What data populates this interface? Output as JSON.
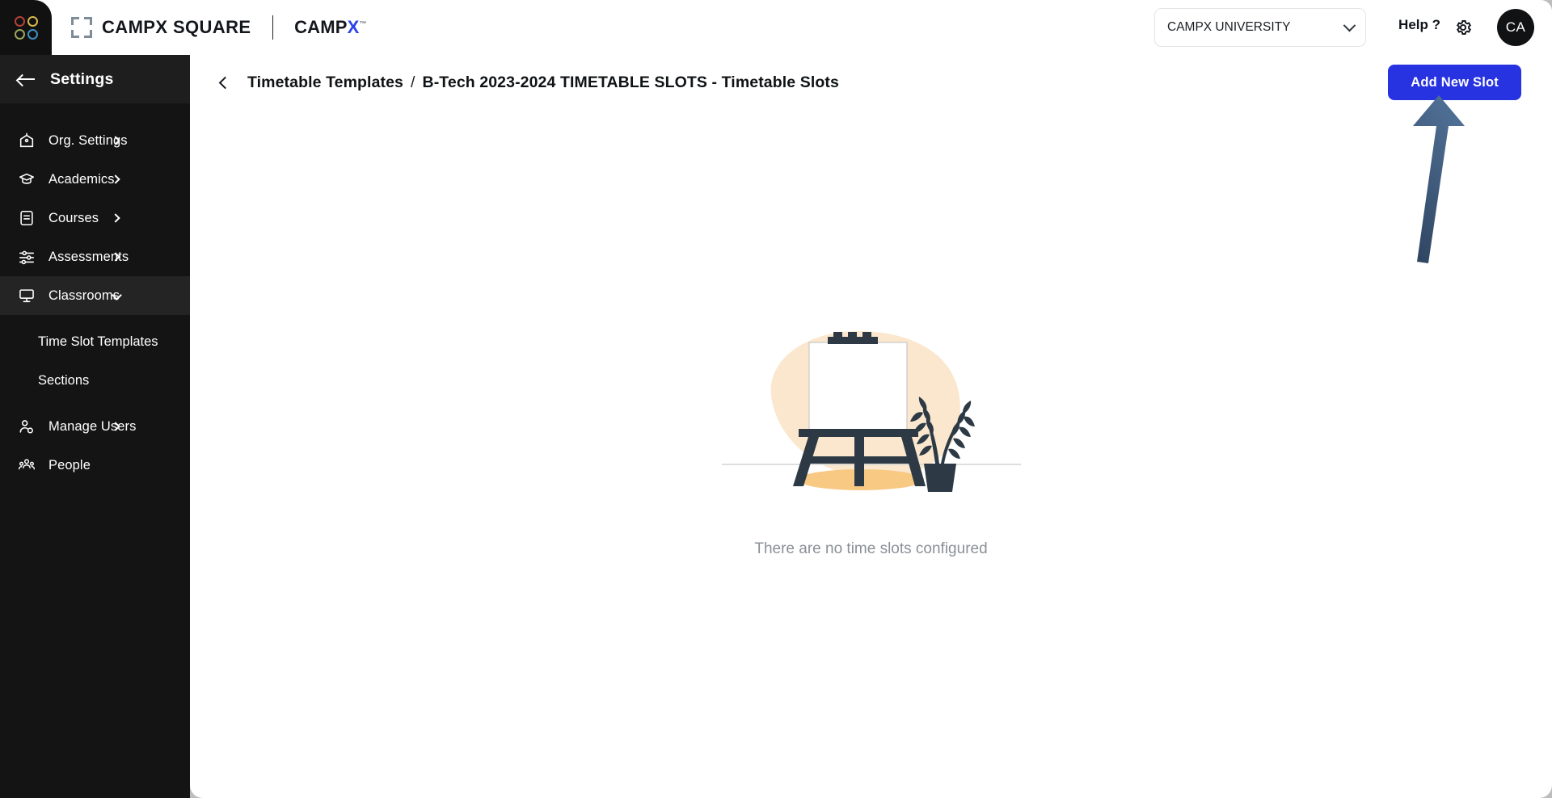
{
  "topbar": {
    "logo_icon": "four-circles-logo",
    "logo_dot_colors": [
      "#b4413a",
      "#d9b84a",
      "#9aa85a",
      "#3f8fc4"
    ],
    "bracket_icon": "expand-brackets-icon",
    "brand_title": "CAMPX SQUARE",
    "brand_alt_prefix": "CAMP",
    "brand_alt_accent": "X",
    "brand_accent_color": "#2b43e8",
    "org_select_value": "CAMPX UNIVERSITY",
    "org_select_icon": "chevron-down-icon",
    "help_label": "Help ?",
    "settings_icon": "gear-icon",
    "avatar_initials": "CA"
  },
  "sidebar": {
    "back_icon": "arrow-left-icon",
    "title": "Settings",
    "items": [
      {
        "label": "Org. Settings",
        "icon": "org-building-icon",
        "chevron": "chevron-right-icon",
        "active": false
      },
      {
        "label": "Academics",
        "icon": "graduation-cap-icon",
        "chevron": "chevron-right-icon",
        "active": false
      },
      {
        "label": "Courses",
        "icon": "document-icon",
        "chevron": "chevron-right-icon",
        "active": false
      },
      {
        "label": "Assessments",
        "icon": "sliders-icon",
        "chevron": "chevron-right-icon",
        "active": false
      },
      {
        "label": "Classrooms",
        "icon": "monitor-icon",
        "chevron": "chevron-down-icon",
        "active": true
      }
    ],
    "sub_items": [
      {
        "label": "Time Slot Templates"
      },
      {
        "label": "Sections"
      }
    ],
    "items_after": [
      {
        "label": "Manage Users",
        "icon": "user-gear-icon",
        "chevron": "chevron-right-icon",
        "active": false
      },
      {
        "label": "People",
        "icon": "people-icon",
        "chevron": "",
        "active": false
      }
    ]
  },
  "main": {
    "back_icon": "chevron-left-icon",
    "breadcrumb_parent": "Timetable Templates",
    "breadcrumb_separator": "/",
    "breadcrumb_current": "B-Tech 2023-2024 TIMETABLE SLOTS - Timetable Slots",
    "add_button_label": "Add New Slot",
    "add_button_color": "#2732e0",
    "empty_illustration": "easel-with-plant-illustration",
    "empty_message": "There are no time slots configured",
    "annotation_arrow": "up-arrow-annotation",
    "annotation_arrow_color": "#3d5a80"
  }
}
